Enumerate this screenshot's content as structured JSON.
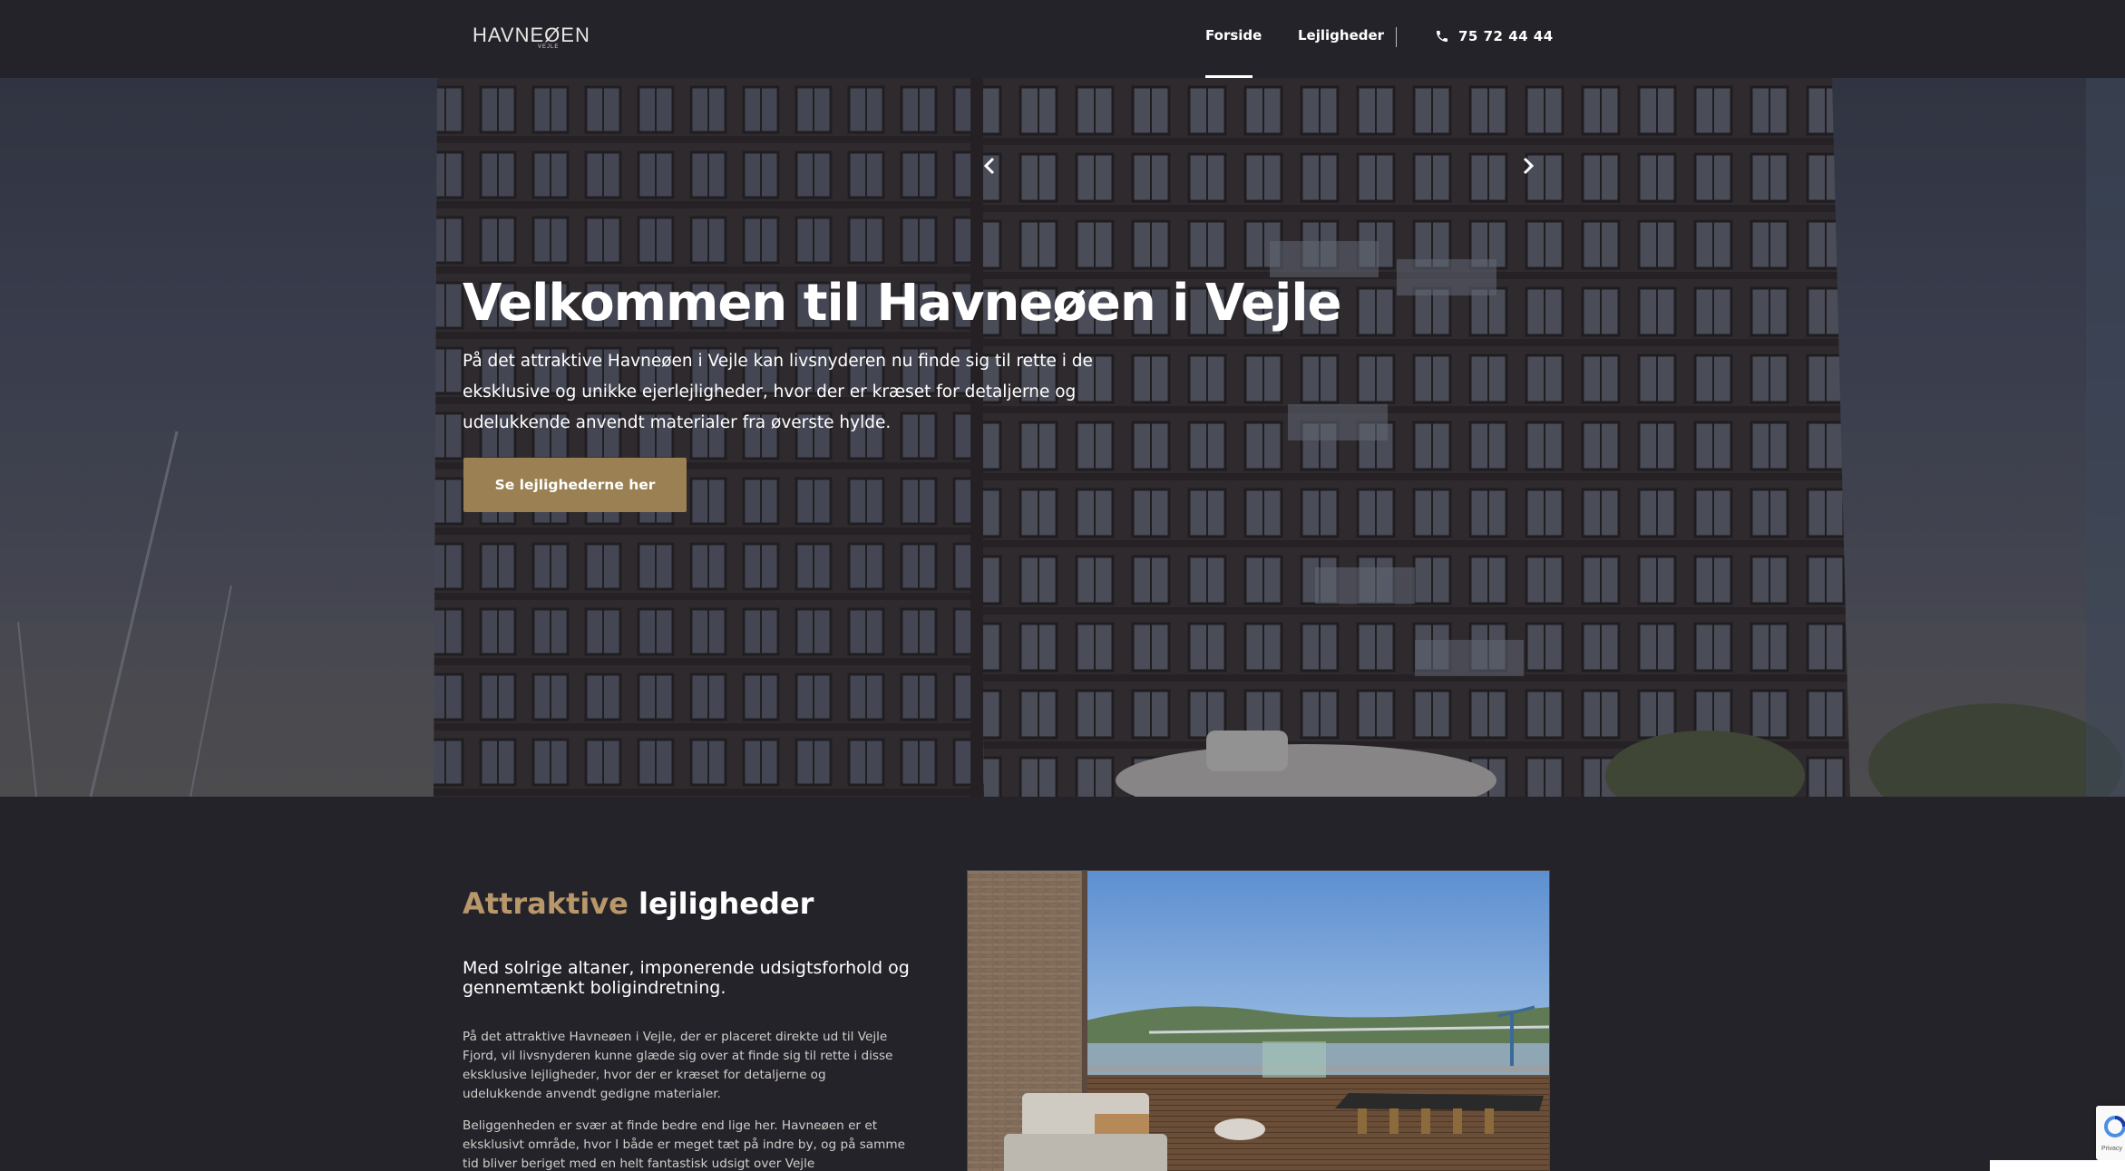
{
  "navbar": {
    "logo_text": "HAVNEØEN",
    "logo_sub": "VEJLE",
    "items": [
      {
        "label": "Forside",
        "active": true
      },
      {
        "label": "Lejligheder",
        "active": false
      }
    ],
    "phone": "75 72 44 44",
    "phone_icon": "phone-icon"
  },
  "hero": {
    "title": "Velkommen til Havneøen i Vejle",
    "text": "På det attraktive Havneøen i Vejle kan livsnyderen nu finde sig til rette i de eksklusive og unikke ejerlejligheder, hvor der er kræset for detaljerne og udelukkende anvendt materialer fra øverste hylde.",
    "button_label": "Se lejlighederne her"
  },
  "section": {
    "heading_accent": "Attraktive",
    "heading_main": "lejligheder",
    "subheading": "Med solrige altaner, imponerende udsigtsforhold og gennemtænkt boligindretning.",
    "paragraph_1": "På det attraktive Havneøen i Vejle, der er placeret direkte ud til Vejle Fjord, vil livsnyderen kunne glæde sig over at finde sig til rette i disse eksklusive lejligheder, hvor der er kræset for detaljerne og udelukkende anvendt gedigne materialer.",
    "paragraph_2": "Beliggenheden er svær at finde bedre end lige her. Havneøen er et eksklusivt område, hvor I både er meget tæt på indre by, og på samme tid bliver beriget med en helt fantastisk udsigt over Vejle"
  },
  "carousel": {
    "prev_icon": "chevron-left-icon",
    "next_icon": "chevron-right-icon"
  },
  "colors": {
    "background": "#25232a",
    "accent": "#b8976a",
    "button": "#9a8052"
  },
  "recaptcha": {
    "text": "Privacy"
  }
}
